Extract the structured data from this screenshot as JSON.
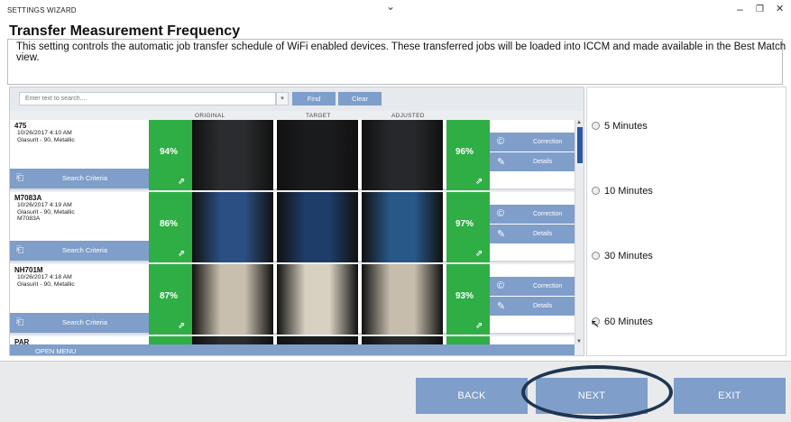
{
  "window": {
    "app_title": "SETTINGS WIZARD",
    "minimize": "–",
    "restore": "❐",
    "close": "✕"
  },
  "header": {
    "title": "Transfer Measurement Frequency",
    "description": "This setting controls the automatic job transfer schedule of WiFi enabled devices.  These transferred jobs will be loaded into ICCM and made available in the Best Match view."
  },
  "search": {
    "placeholder": "Enter text to search....",
    "find_label": "Find",
    "clear_label": "Clear"
  },
  "columns": [
    "ORIGINAL",
    "TARGET",
    "ADJUSTED"
  ],
  "jobs": [
    {
      "name": "475",
      "info": "10/26/2017 4:10 AM\nGlasurit - 90, Metallic",
      "original_pct": "94%",
      "adjusted_pct": "96%",
      "swatch_colors": [
        "#2a2c2f",
        "#1a1b1d",
        "#26282b"
      ],
      "criteria_label": "Search Criteria",
      "correction_label": "Correction",
      "details_label": "Details"
    },
    {
      "name": "M7083A",
      "info": "10/26/2017 4:19 AM\nGlasurit - 90, Metallic\nM7083A",
      "original_pct": "86%",
      "adjusted_pct": "97%",
      "swatch_colors": [
        "#2a4f82",
        "#1e3d68",
        "#275888"
      ],
      "criteria_label": "Search Criteria",
      "correction_label": "Correction",
      "details_label": "Details"
    },
    {
      "name": "NH701M",
      "info": "10/26/2017 4:18 AM\nGlasurit - 90, Metallic",
      "original_pct": "87%",
      "adjusted_pct": "93%",
      "swatch_colors": [
        "#c9bfae",
        "#d8d0c0",
        "#c6bdac"
      ],
      "criteria_label": "Search Criteria",
      "correction_label": "Correction",
      "details_label": "Details"
    },
    {
      "name": "PAR",
      "info": "",
      "original_pct": "",
      "adjusted_pct": "",
      "swatch_colors": [
        "#2b2b2b",
        "#1d1d1d",
        "#2a2a2a"
      ],
      "criteria_label": "",
      "correction_label": "",
      "details_label": ""
    }
  ],
  "open_menu_label": "OPEN MENU",
  "frequency_options": [
    {
      "label": "5 Minutes",
      "selected": false
    },
    {
      "label": "10 Minutes",
      "selected": false
    },
    {
      "label": "30 Minutes",
      "selected": false
    },
    {
      "label": "60 Minutes",
      "selected": false
    }
  ],
  "footer": {
    "back_label": "BACK",
    "next_label": "NEXT",
    "exit_label": "EXIT"
  },
  "colors": {
    "accent": "#7f9ec9",
    "match_green": "#2fae45",
    "highlight_ring": "#1f3550"
  }
}
